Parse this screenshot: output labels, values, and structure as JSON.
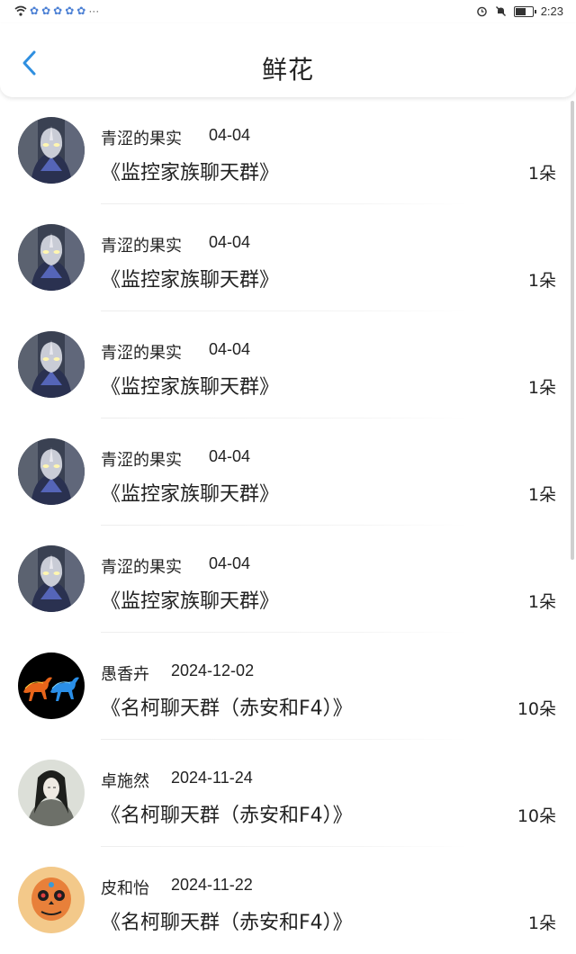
{
  "status_bar": {
    "time": "2:23",
    "notification_icons": [
      "wifi-icon",
      "app-icon",
      "app-icon",
      "app-icon",
      "app-icon",
      "app-icon"
    ],
    "more": "···"
  },
  "header": {
    "title": "鲜花"
  },
  "items": [
    {
      "name": "青涩的果实",
      "date": "04-04",
      "group": "《监控家族聊天群》",
      "count": "1朵",
      "avatar": "hero-avatar"
    },
    {
      "name": "青涩的果实",
      "date": "04-04",
      "group": "《监控家族聊天群》",
      "count": "1朵",
      "avatar": "hero-avatar"
    },
    {
      "name": "青涩的果实",
      "date": "04-04",
      "group": "《监控家族聊天群》",
      "count": "1朵",
      "avatar": "hero-avatar"
    },
    {
      "name": "青涩的果实",
      "date": "04-04",
      "group": "《监控家族聊天群》",
      "count": "1朵",
      "avatar": "hero-avatar"
    },
    {
      "name": "青涩的果实",
      "date": "04-04",
      "group": "《监控家族聊天群》",
      "count": "1朵",
      "avatar": "hero-avatar"
    },
    {
      "name": "愚香卉",
      "date": "2024-12-02",
      "group": "《名柯聊天群（赤安和F4）》",
      "count": "10朵",
      "avatar": "horses-avatar"
    },
    {
      "name": "卓施然",
      "date": "2024-11-24",
      "group": "《名柯聊天群（赤安和F4）》",
      "count": "10朵",
      "avatar": "ink-figure-avatar"
    },
    {
      "name": "皮和怡",
      "date": "2024-11-22",
      "group": "《名柯聊天群（赤安和F4）》",
      "count": "1朵",
      "avatar": "skull-avatar"
    }
  ],
  "colors": {
    "accent": "#2f8fe0"
  }
}
